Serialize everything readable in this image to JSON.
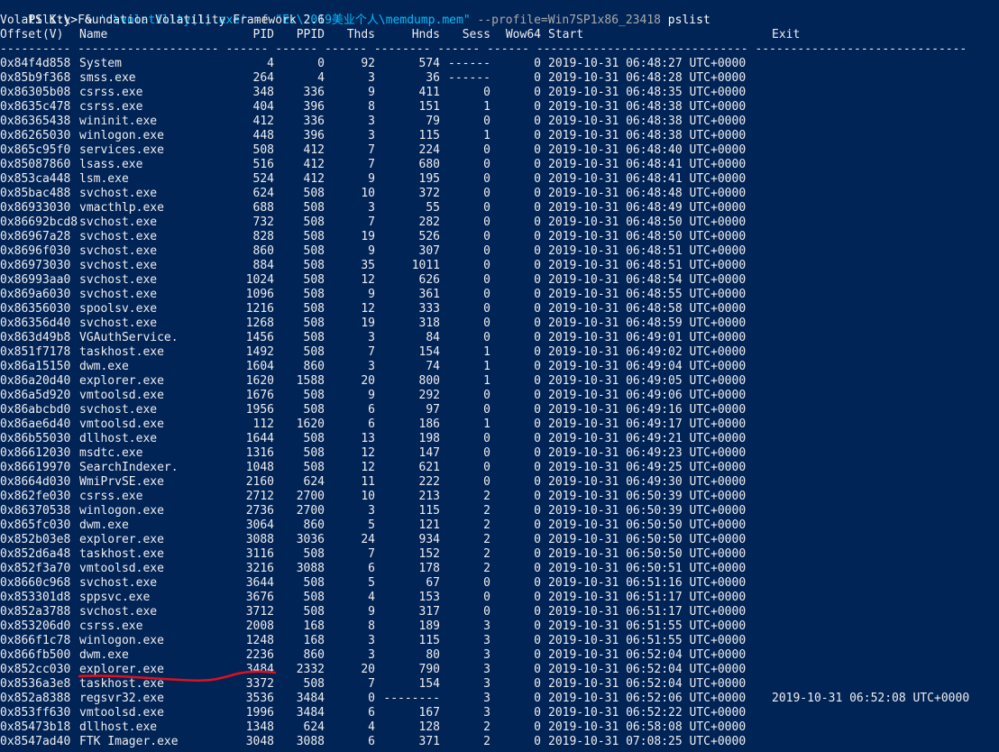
{
  "command": {
    "prompt": "PS K:\\> ",
    "amp": "& ",
    "exe": "'.\\volatility(1).exe'",
    "flag_f": " -f ",
    "file": "\"E:\\2019美业个人\\memdump.mem\"",
    "flag_profile": " --profile=Win7SP1x86_23418",
    "plugin": " pslist"
  },
  "banner": "Volatility Foundation Volatility Framework 2.6",
  "headers": {
    "offset": "Offset(V)",
    "name": "Name",
    "pid": "PID",
    "ppid": "PPID",
    "thds": "Thds",
    "hnds": "Hnds",
    "sess": "Sess",
    "wow64": "Wow64",
    "start": "Start",
    "exit": "Exit"
  },
  "separator": "---------- -------------------- ------ ------ ------ -------- ------ ------ ------------------------------ ------------------------------",
  "processes": [
    {
      "offset": "0x84f4d858",
      "name": "System",
      "pid": "4",
      "ppid": "0",
      "thds": "92",
      "hnds": "574",
      "sess": "------",
      "wow64": "0",
      "start": "2019-10-31 06:48:27 UTC+0000",
      "exit": ""
    },
    {
      "offset": "0x85b9f368",
      "name": "smss.exe",
      "pid": "264",
      "ppid": "4",
      "thds": "3",
      "hnds": "36",
      "sess": "------",
      "wow64": "0",
      "start": "2019-10-31 06:48:28 UTC+0000",
      "exit": ""
    },
    {
      "offset": "0x86305b08",
      "name": "csrss.exe",
      "pid": "348",
      "ppid": "336",
      "thds": "9",
      "hnds": "411",
      "sess": "0",
      "wow64": "0",
      "start": "2019-10-31 06:48:35 UTC+0000",
      "exit": ""
    },
    {
      "offset": "0x8635c478",
      "name": "csrss.exe",
      "pid": "404",
      "ppid": "396",
      "thds": "8",
      "hnds": "151",
      "sess": "1",
      "wow64": "0",
      "start": "2019-10-31 06:48:38 UTC+0000",
      "exit": ""
    },
    {
      "offset": "0x86365438",
      "name": "wininit.exe",
      "pid": "412",
      "ppid": "336",
      "thds": "3",
      "hnds": "79",
      "sess": "0",
      "wow64": "0",
      "start": "2019-10-31 06:48:38 UTC+0000",
      "exit": ""
    },
    {
      "offset": "0x86265030",
      "name": "winlogon.exe",
      "pid": "448",
      "ppid": "396",
      "thds": "3",
      "hnds": "115",
      "sess": "1",
      "wow64": "0",
      "start": "2019-10-31 06:48:38 UTC+0000",
      "exit": ""
    },
    {
      "offset": "0x865c95f0",
      "name": "services.exe",
      "pid": "508",
      "ppid": "412",
      "thds": "7",
      "hnds": "224",
      "sess": "0",
      "wow64": "0",
      "start": "2019-10-31 06:48:40 UTC+0000",
      "exit": ""
    },
    {
      "offset": "0x85087860",
      "name": "lsass.exe",
      "pid": "516",
      "ppid": "412",
      "thds": "7",
      "hnds": "680",
      "sess": "0",
      "wow64": "0",
      "start": "2019-10-31 06:48:41 UTC+0000",
      "exit": ""
    },
    {
      "offset": "0x853ca448",
      "name": "lsm.exe",
      "pid": "524",
      "ppid": "412",
      "thds": "9",
      "hnds": "195",
      "sess": "0",
      "wow64": "0",
      "start": "2019-10-31 06:48:41 UTC+0000",
      "exit": ""
    },
    {
      "offset": "0x85bac488",
      "name": "svchost.exe",
      "pid": "624",
      "ppid": "508",
      "thds": "10",
      "hnds": "372",
      "sess": "0",
      "wow64": "0",
      "start": "2019-10-31 06:48:48 UTC+0000",
      "exit": ""
    },
    {
      "offset": "0x86933030",
      "name": "vmacthlp.exe",
      "pid": "688",
      "ppid": "508",
      "thds": "3",
      "hnds": "55",
      "sess": "0",
      "wow64": "0",
      "start": "2019-10-31 06:48:49 UTC+0000",
      "exit": ""
    },
    {
      "offset": "0x86692bcd8",
      "name": "svchost.exe",
      "pid": "732",
      "ppid": "508",
      "thds": "7",
      "hnds": "282",
      "sess": "0",
      "wow64": "0",
      "start": "2019-10-31 06:48:50 UTC+0000",
      "exit": ""
    },
    {
      "offset": "0x86967a28",
      "name": "svchost.exe",
      "pid": "828",
      "ppid": "508",
      "thds": "19",
      "hnds": "526",
      "sess": "0",
      "wow64": "0",
      "start": "2019-10-31 06:48:50 UTC+0000",
      "exit": ""
    },
    {
      "offset": "0x8696f030",
      "name": "svchost.exe",
      "pid": "860",
      "ppid": "508",
      "thds": "9",
      "hnds": "307",
      "sess": "0",
      "wow64": "0",
      "start": "2019-10-31 06:48:51 UTC+0000",
      "exit": ""
    },
    {
      "offset": "0x86973030",
      "name": "svchost.exe",
      "pid": "884",
      "ppid": "508",
      "thds": "35",
      "hnds": "1011",
      "sess": "0",
      "wow64": "0",
      "start": "2019-10-31 06:48:51 UTC+0000",
      "exit": ""
    },
    {
      "offset": "0x86993aa0",
      "name": "svchost.exe",
      "pid": "1024",
      "ppid": "508",
      "thds": "12",
      "hnds": "626",
      "sess": "0",
      "wow64": "0",
      "start": "2019-10-31 06:48:54 UTC+0000",
      "exit": ""
    },
    {
      "offset": "0x869a6030",
      "name": "svchost.exe",
      "pid": "1096",
      "ppid": "508",
      "thds": "9",
      "hnds": "361",
      "sess": "0",
      "wow64": "0",
      "start": "2019-10-31 06:48:55 UTC+0000",
      "exit": ""
    },
    {
      "offset": "0x86356030",
      "name": "spoolsv.exe",
      "pid": "1216",
      "ppid": "508",
      "thds": "12",
      "hnds": "333",
      "sess": "0",
      "wow64": "0",
      "start": "2019-10-31 06:48:58 UTC+0000",
      "exit": ""
    },
    {
      "offset": "0x86356d40",
      "name": "svchost.exe",
      "pid": "1268",
      "ppid": "508",
      "thds": "19",
      "hnds": "318",
      "sess": "0",
      "wow64": "0",
      "start": "2019-10-31 06:48:59 UTC+0000",
      "exit": ""
    },
    {
      "offset": "0x863d49b8",
      "name": "VGAuthService.",
      "pid": "1456",
      "ppid": "508",
      "thds": "3",
      "hnds": "84",
      "sess": "0",
      "wow64": "0",
      "start": "2019-10-31 06:49:01 UTC+0000",
      "exit": ""
    },
    {
      "offset": "0x851f7178",
      "name": "taskhost.exe",
      "pid": "1492",
      "ppid": "508",
      "thds": "7",
      "hnds": "154",
      "sess": "1",
      "wow64": "0",
      "start": "2019-10-31 06:49:02 UTC+0000",
      "exit": ""
    },
    {
      "offset": "0x86a15150",
      "name": "dwm.exe",
      "pid": "1604",
      "ppid": "860",
      "thds": "3",
      "hnds": "74",
      "sess": "1",
      "wow64": "0",
      "start": "2019-10-31 06:49:04 UTC+0000",
      "exit": ""
    },
    {
      "offset": "0x86a20d40",
      "name": "explorer.exe",
      "pid": "1620",
      "ppid": "1588",
      "thds": "20",
      "hnds": "800",
      "sess": "1",
      "wow64": "0",
      "start": "2019-10-31 06:49:05 UTC+0000",
      "exit": ""
    },
    {
      "offset": "0x86a5d920",
      "name": "vmtoolsd.exe",
      "pid": "1676",
      "ppid": "508",
      "thds": "9",
      "hnds": "292",
      "sess": "0",
      "wow64": "0",
      "start": "2019-10-31 06:49:06 UTC+0000",
      "exit": ""
    },
    {
      "offset": "0x86abcbd0",
      "name": "svchost.exe",
      "pid": "1956",
      "ppid": "508",
      "thds": "6",
      "hnds": "97",
      "sess": "0",
      "wow64": "0",
      "start": "2019-10-31 06:49:16 UTC+0000",
      "exit": ""
    },
    {
      "offset": "0x86ae6d40",
      "name": "vmtoolsd.exe",
      "pid": "112",
      "ppid": "1620",
      "thds": "6",
      "hnds": "186",
      "sess": "1",
      "wow64": "0",
      "start": "2019-10-31 06:49:17 UTC+0000",
      "exit": ""
    },
    {
      "offset": "0x86b55030",
      "name": "dllhost.exe",
      "pid": "1644",
      "ppid": "508",
      "thds": "13",
      "hnds": "198",
      "sess": "0",
      "wow64": "0",
      "start": "2019-10-31 06:49:21 UTC+0000",
      "exit": ""
    },
    {
      "offset": "0x86612030",
      "name": "msdtc.exe",
      "pid": "1316",
      "ppid": "508",
      "thds": "12",
      "hnds": "147",
      "sess": "0",
      "wow64": "0",
      "start": "2019-10-31 06:49:23 UTC+0000",
      "exit": ""
    },
    {
      "offset": "0x86619970",
      "name": "SearchIndexer.",
      "pid": "1048",
      "ppid": "508",
      "thds": "12",
      "hnds": "621",
      "sess": "0",
      "wow64": "0",
      "start": "2019-10-31 06:49:25 UTC+0000",
      "exit": ""
    },
    {
      "offset": "0x8664d030",
      "name": "WmiPrvSE.exe",
      "pid": "2160",
      "ppid": "624",
      "thds": "11",
      "hnds": "222",
      "sess": "0",
      "wow64": "0",
      "start": "2019-10-31 06:49:30 UTC+0000",
      "exit": ""
    },
    {
      "offset": "0x862fe030",
      "name": "csrss.exe",
      "pid": "2712",
      "ppid": "2700",
      "thds": "10",
      "hnds": "213",
      "sess": "2",
      "wow64": "0",
      "start": "2019-10-31 06:50:39 UTC+0000",
      "exit": ""
    },
    {
      "offset": "0x86370538",
      "name": "winlogon.exe",
      "pid": "2736",
      "ppid": "2700",
      "thds": "3",
      "hnds": "115",
      "sess": "2",
      "wow64": "0",
      "start": "2019-10-31 06:50:39 UTC+0000",
      "exit": ""
    },
    {
      "offset": "0x865fc030",
      "name": "dwm.exe",
      "pid": "3064",
      "ppid": "860",
      "thds": "5",
      "hnds": "121",
      "sess": "2",
      "wow64": "0",
      "start": "2019-10-31 06:50:50 UTC+0000",
      "exit": ""
    },
    {
      "offset": "0x852b03e8",
      "name": "explorer.exe",
      "pid": "3088",
      "ppid": "3036",
      "thds": "24",
      "hnds": "934",
      "sess": "2",
      "wow64": "0",
      "start": "2019-10-31 06:50:50 UTC+0000",
      "exit": ""
    },
    {
      "offset": "0x852d6a48",
      "name": "taskhost.exe",
      "pid": "3116",
      "ppid": "508",
      "thds": "7",
      "hnds": "152",
      "sess": "2",
      "wow64": "0",
      "start": "2019-10-31 06:50:50 UTC+0000",
      "exit": ""
    },
    {
      "offset": "0x852f3a70",
      "name": "vmtoolsd.exe",
      "pid": "3216",
      "ppid": "3088",
      "thds": "6",
      "hnds": "178",
      "sess": "2",
      "wow64": "0",
      "start": "2019-10-31 06:50:51 UTC+0000",
      "exit": ""
    },
    {
      "offset": "0x8660c968",
      "name": "svchost.exe",
      "pid": "3644",
      "ppid": "508",
      "thds": "5",
      "hnds": "67",
      "sess": "0",
      "wow64": "0",
      "start": "2019-10-31 06:51:16 UTC+0000",
      "exit": ""
    },
    {
      "offset": "0x853301d8",
      "name": "sppsvc.exe",
      "pid": "3676",
      "ppid": "508",
      "thds": "4",
      "hnds": "153",
      "sess": "0",
      "wow64": "0",
      "start": "2019-10-31 06:51:17 UTC+0000",
      "exit": ""
    },
    {
      "offset": "0x852a3788",
      "name": "svchost.exe",
      "pid": "3712",
      "ppid": "508",
      "thds": "9",
      "hnds": "317",
      "sess": "0",
      "wow64": "0",
      "start": "2019-10-31 06:51:17 UTC+0000",
      "exit": ""
    },
    {
      "offset": "0x853206d0",
      "name": "csrss.exe",
      "pid": "2008",
      "ppid": "168",
      "thds": "8",
      "hnds": "189",
      "sess": "3",
      "wow64": "0",
      "start": "2019-10-31 06:51:55 UTC+0000",
      "exit": ""
    },
    {
      "offset": "0x866f1c78",
      "name": "winlogon.exe",
      "pid": "1248",
      "ppid": "168",
      "thds": "3",
      "hnds": "115",
      "sess": "3",
      "wow64": "0",
      "start": "2019-10-31 06:51:55 UTC+0000",
      "exit": ""
    },
    {
      "offset": "0x866fb500",
      "name": "dwm.exe",
      "pid": "2236",
      "ppid": "860",
      "thds": "3",
      "hnds": "80",
      "sess": "3",
      "wow64": "0",
      "start": "2019-10-31 06:52:04 UTC+0000",
      "exit": ""
    },
    {
      "offset": "0x852cc030",
      "name": "explorer.exe",
      "pid": "3484",
      "ppid": "2332",
      "thds": "20",
      "hnds": "790",
      "sess": "3",
      "wow64": "0",
      "start": "2019-10-31 06:52:04 UTC+0000",
      "exit": ""
    },
    {
      "offset": "0x8536a3e8",
      "name": "taskhost.exe",
      "pid": "3372",
      "ppid": "508",
      "thds": "7",
      "hnds": "154",
      "sess": "3",
      "wow64": "0",
      "start": "2019-10-31 06:52:04 UTC+0000",
      "exit": ""
    },
    {
      "offset": "0x852a8388",
      "name": "regsvr32.exe",
      "pid": "3536",
      "ppid": "3484",
      "thds": "0",
      "hnds": "--------",
      "sess": "3",
      "wow64": "0",
      "start": "2019-10-31 06:52:06 UTC+0000",
      "exit": "2019-10-31 06:52:08 UTC+0000"
    },
    {
      "offset": "0x853ff630",
      "name": "vmtoolsd.exe",
      "pid": "1996",
      "ppid": "3484",
      "thds": "6",
      "hnds": "167",
      "sess": "3",
      "wow64": "0",
      "start": "2019-10-31 06:52:22 UTC+0000",
      "exit": ""
    },
    {
      "offset": "0x85473b18",
      "name": "dllhost.exe",
      "pid": "1348",
      "ppid": "624",
      "thds": "4",
      "hnds": "128",
      "sess": "2",
      "wow64": "0",
      "start": "2019-10-31 06:58:08 UTC+0000",
      "exit": ""
    },
    {
      "offset": "0x8547ad40",
      "name": "FTK Imager.exe",
      "pid": "3048",
      "ppid": "3088",
      "thds": "6",
      "hnds": "371",
      "sess": "2",
      "wow64": "0",
      "start": "2019-10-31 07:08:25 UTC+0000",
      "exit": ""
    }
  ],
  "colors": {
    "background": "#012456",
    "text": "#eeedf0",
    "annotation": "#e0101a"
  }
}
